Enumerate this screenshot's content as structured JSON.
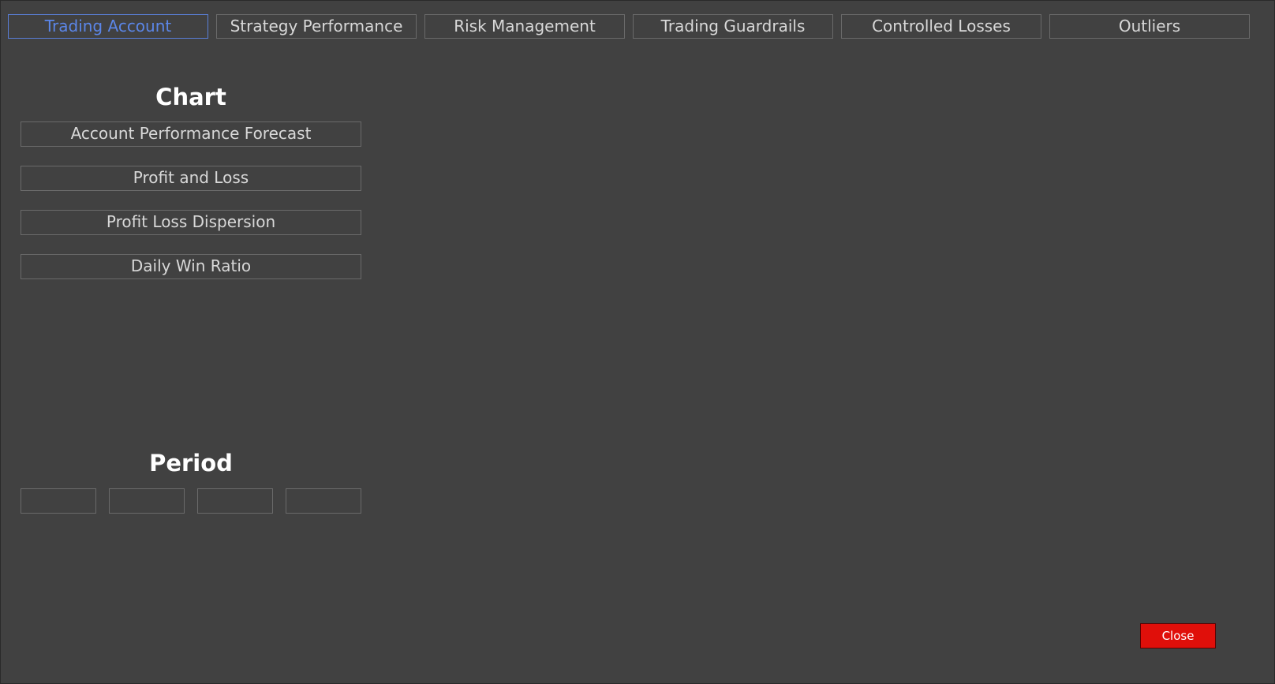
{
  "tabs": [
    {
      "label": "Trading Account",
      "active": true
    },
    {
      "label": "Strategy Performance"
    },
    {
      "label": "Risk Management"
    },
    {
      "label": "Trading Guardrails"
    },
    {
      "label": "Controlled Losses"
    },
    {
      "label": "Outliers"
    }
  ],
  "chart_section": {
    "title": "Chart",
    "buttons": [
      "Account Performance Forecast",
      "Profit and Loss",
      "Profit Loss Dispersion",
      "Daily Win Ratio"
    ]
  },
  "period_section": {
    "title": "Period",
    "buttons": [
      "",
      "",
      "",
      ""
    ]
  },
  "close_label": "Close",
  "colors": {
    "background": "#414141",
    "active_tab": "#5b86e8",
    "close_button": "#e00f0a"
  }
}
